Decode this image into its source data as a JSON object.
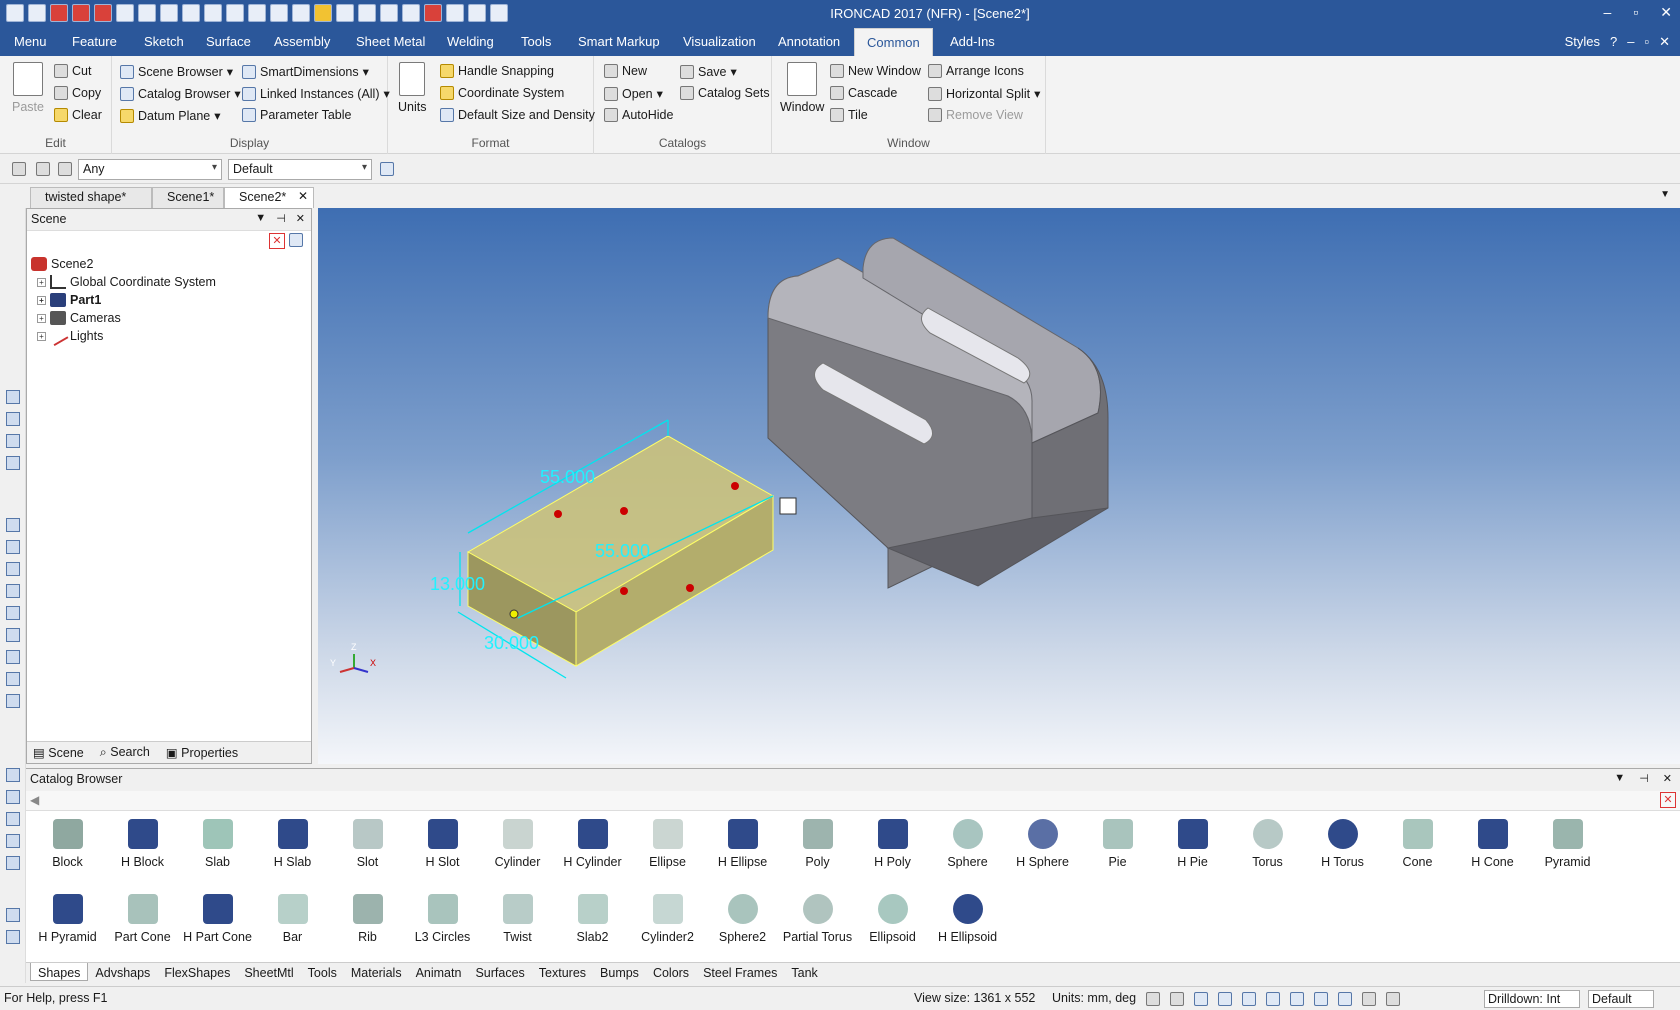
{
  "title": "IRONCAD 2017 (NFR) - [Scene2*]",
  "window_controls": [
    "–",
    "▫",
    "✕"
  ],
  "menu": {
    "tabs": [
      "Menu",
      "Feature",
      "Sketch",
      "Surface",
      "Assembly",
      "Sheet Metal",
      "Welding",
      "Tools",
      "Smart Markup",
      "Visualization",
      "Annotation",
      "Common",
      "Add-Ins"
    ],
    "active": "Common",
    "styles": "Styles",
    "mdi_controls": [
      "–",
      "▫",
      "✕"
    ]
  },
  "ribbon": {
    "edit": {
      "label": "Edit",
      "paste": "Paste",
      "cut": "Cut",
      "copy": "Copy",
      "clear": "Clear"
    },
    "display": {
      "label": "Display",
      "scene_browser": "Scene Browser",
      "catalog_browser": "Catalog Browser",
      "datum_plane": "Datum Plane",
      "smart_dimensions": "SmartDimensions",
      "linked_instances": "Linked Instances (All)",
      "parameter_table": "Parameter Table"
    },
    "format": {
      "label": "Format",
      "units": "Units",
      "handle_snapping": "Handle Snapping",
      "coordinate_system": "Coordinate System",
      "default_size": "Default Size and Density"
    },
    "catalogs": {
      "label": "Catalogs",
      "new": "New",
      "open": "Open",
      "autohide": "AutoHide",
      "save": "Save",
      "catalog_sets": "Catalog Sets"
    },
    "window": {
      "label": "Window",
      "window": "Window",
      "new_window": "New Window",
      "cascade": "Cascade",
      "tile": "Tile",
      "arrange_icons": "Arrange Icons",
      "horizontal_split": "Horizontal Split",
      "remove_view": "Remove View"
    }
  },
  "selection": {
    "filter": "Any",
    "style": "Default"
  },
  "doc_tabs": [
    "twisted shape*",
    "Scene1*",
    "Scene2*"
  ],
  "active_doc": "Scene2*",
  "scene_panel": {
    "title": "Scene",
    "root": "Scene2",
    "items": [
      "Global Coordinate System",
      "Part1",
      "Cameras",
      "Lights"
    ],
    "footer_tabs": [
      "Scene",
      "Search",
      "Properties"
    ]
  },
  "viewport": {
    "dims": [
      "55.000",
      "55.000",
      "13.000",
      "30.000"
    ],
    "axes": [
      "Z",
      "Y",
      "X"
    ]
  },
  "catalog_panel": {
    "title": "Catalog Browser",
    "shapes": [
      "Block",
      "H Block",
      "Slab",
      "H Slab",
      "Slot",
      "H Slot",
      "Cylinder",
      "H Cylinder",
      "Ellipse",
      "H Ellipse",
      "Poly",
      "H Poly",
      "Sphere",
      "H Sphere",
      "Pie",
      "H Pie",
      "Torus",
      "H Torus",
      "Cone",
      "H Cone",
      "Pyramid",
      "H Pyramid",
      "Part Cone",
      "H Part Cone",
      "Bar",
      "Rib",
      "L3 Circles",
      "Twist",
      "Slab2",
      "Cylinder2",
      "Sphere2",
      "Partial Torus",
      "Ellipsoid",
      "H Ellipsoid"
    ],
    "tabs": [
      "Shapes",
      "Advshaps",
      "FlexShapes",
      "SheetMtl",
      "Tools",
      "Materials",
      "Animatn",
      "Surfaces",
      "Textures",
      "Bumps",
      "Colors",
      "Steel Frames",
      "Tank"
    ],
    "active_tab": "Shapes"
  },
  "status": {
    "help": "For Help, press F1",
    "view_size": "View size: 1361 x  552",
    "units": "Units: mm, deg",
    "drilldown": "Drilldown: Int",
    "style": "Default"
  },
  "colors": {
    "accent": "#2b579a",
    "box_fill": "#bdb77e",
    "dim": "#00e5ee",
    "part": "#8e8e93"
  }
}
